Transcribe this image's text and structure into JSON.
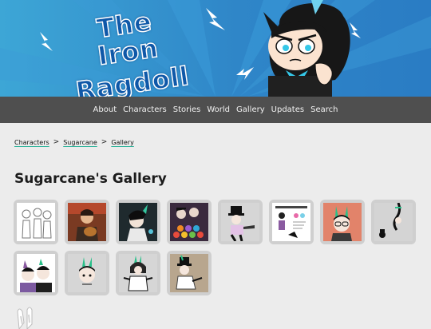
{
  "site": {
    "title_line1": "The Iron",
    "title_line2": "Ragdoll"
  },
  "nav": [
    "About",
    "Characters",
    "Stories",
    "World",
    "Gallery",
    "Updates",
    "Search"
  ],
  "breadcrumb": [
    "Characters",
    "Sugarcane",
    "Gallery"
  ],
  "breadcrumb_separator": ">",
  "page": {
    "heading": "Sugarcane's Gallery"
  },
  "gallery": {
    "row1": [
      "sketch-lineup",
      "guitar-portrait",
      "dark-character-art",
      "crowd-scene",
      "tophat-pointing",
      "reference-sheet",
      "bunny-portrait-red-bg",
      "hanging-character"
    ],
    "row2": [
      "duo-portrait",
      "bunny-head-sketch",
      "bunny-figure",
      "tophat-seated"
    ]
  },
  "colors": {
    "banner": "#2f86c8",
    "nav": "#4f4f4f",
    "accent": "#2eb39a",
    "background": "#ececec"
  }
}
